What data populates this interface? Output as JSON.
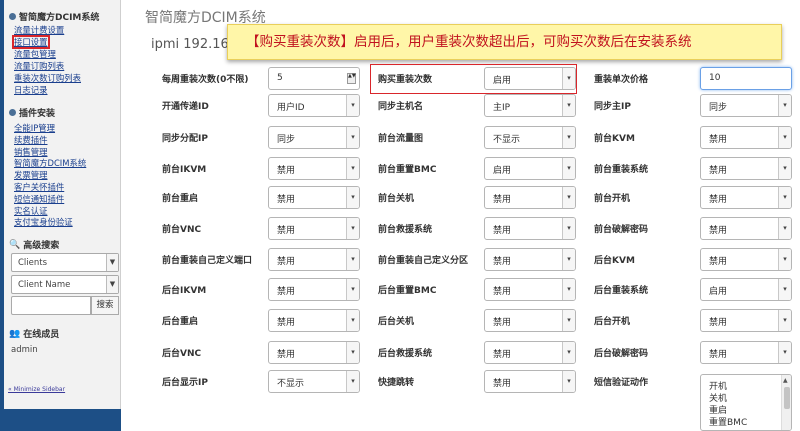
{
  "sidebar": {
    "section1_title": "智简魔方DCIM系统",
    "section1_links": [
      "流量计费设置",
      "接口设置",
      "流量包管理",
      "流量订购列表",
      "重装次数订购列表",
      "日志记录"
    ],
    "section2_title": "插件安装",
    "section2_links": [
      "全能IP管理",
      "续费插件",
      "销售管理",
      "智简魔方DCIM系统",
      "发票管理",
      "客户关怀插件",
      "短信通知插件",
      "实名认证",
      "支付宝身份验证"
    ],
    "search_title": "高级搜索",
    "select1": "Clients",
    "select2": "Client Name",
    "search_button": "搜索",
    "online_title": "在线成员",
    "online_user": "admin",
    "minimize": "« Minimize Sidebar"
  },
  "main": {
    "title": "智简魔方DCIM系统",
    "ipmi_text": "ipmi 192.168",
    "banner": "【购买重装次数】启用后，用户重装次数超出后，可购买次数后在安装系统"
  },
  "fields": [
    {
      "label": "每周重装次数(0不限)",
      "value": "5",
      "type": "number"
    },
    {
      "label": "购买重装次数",
      "value": "启用",
      "type": "select"
    },
    {
      "label": "重装单次价格",
      "value": "10",
      "type": "text"
    },
    {
      "label": "开通传递ID",
      "value": "用户ID",
      "type": "select"
    },
    {
      "label": "同步主机名",
      "value": "主IP",
      "type": "select"
    },
    {
      "label": "同步主IP",
      "value": "同步",
      "type": "select"
    },
    {
      "label": "同步分配IP",
      "value": "同步",
      "type": "select"
    },
    {
      "label": "前台流量图",
      "value": "不显示",
      "type": "select"
    },
    {
      "label": "前台KVM",
      "value": "禁用",
      "type": "select"
    },
    {
      "label": "前台IKVM",
      "value": "禁用",
      "type": "select"
    },
    {
      "label": "前台重置BMC",
      "value": "启用",
      "type": "select"
    },
    {
      "label": "前台重装系统",
      "value": "禁用",
      "type": "select"
    },
    {
      "label": "前台重启",
      "value": "禁用",
      "type": "select"
    },
    {
      "label": "前台关机",
      "value": "禁用",
      "type": "select"
    },
    {
      "label": "前台开机",
      "value": "禁用",
      "type": "select"
    },
    {
      "label": "前台VNC",
      "value": "禁用",
      "type": "select"
    },
    {
      "label": "前台救援系统",
      "value": "禁用",
      "type": "select"
    },
    {
      "label": "前台破解密码",
      "value": "禁用",
      "type": "select"
    },
    {
      "label": "前台重装自己定义端口",
      "value": "禁用",
      "type": "select"
    },
    {
      "label": "前台重装自己定义分区",
      "value": "禁用",
      "type": "select"
    },
    {
      "label": "后台KVM",
      "value": "禁用",
      "type": "select"
    },
    {
      "label": "后台IKVM",
      "value": "禁用",
      "type": "select"
    },
    {
      "label": "后台重置BMC",
      "value": "禁用",
      "type": "select"
    },
    {
      "label": "后台重装系统",
      "value": "启用",
      "type": "select"
    },
    {
      "label": "后台重启",
      "value": "禁用",
      "type": "select"
    },
    {
      "label": "后台关机",
      "value": "禁用",
      "type": "select"
    },
    {
      "label": "后台开机",
      "value": "禁用",
      "type": "select"
    },
    {
      "label": "后台VNC",
      "value": "禁用",
      "type": "select"
    },
    {
      "label": "后台救援系统",
      "value": "禁用",
      "type": "select"
    },
    {
      "label": "后台破解密码",
      "value": "禁用",
      "type": "select"
    },
    {
      "label": "后台显示IP",
      "value": "不显示",
      "type": "select"
    },
    {
      "label": "快捷跳转",
      "value": "禁用",
      "type": "select"
    },
    {
      "label": "短信验证动作",
      "value": "",
      "type": "listbox"
    }
  ],
  "sms_options": [
    "开机",
    "关机",
    "重启",
    "重置BMC"
  ],
  "colors": {
    "accent_red": "#d9262b",
    "banner_bg": "#fff6a8",
    "link": "#1a3f8e",
    "nav_blue": "#1d4f86"
  }
}
